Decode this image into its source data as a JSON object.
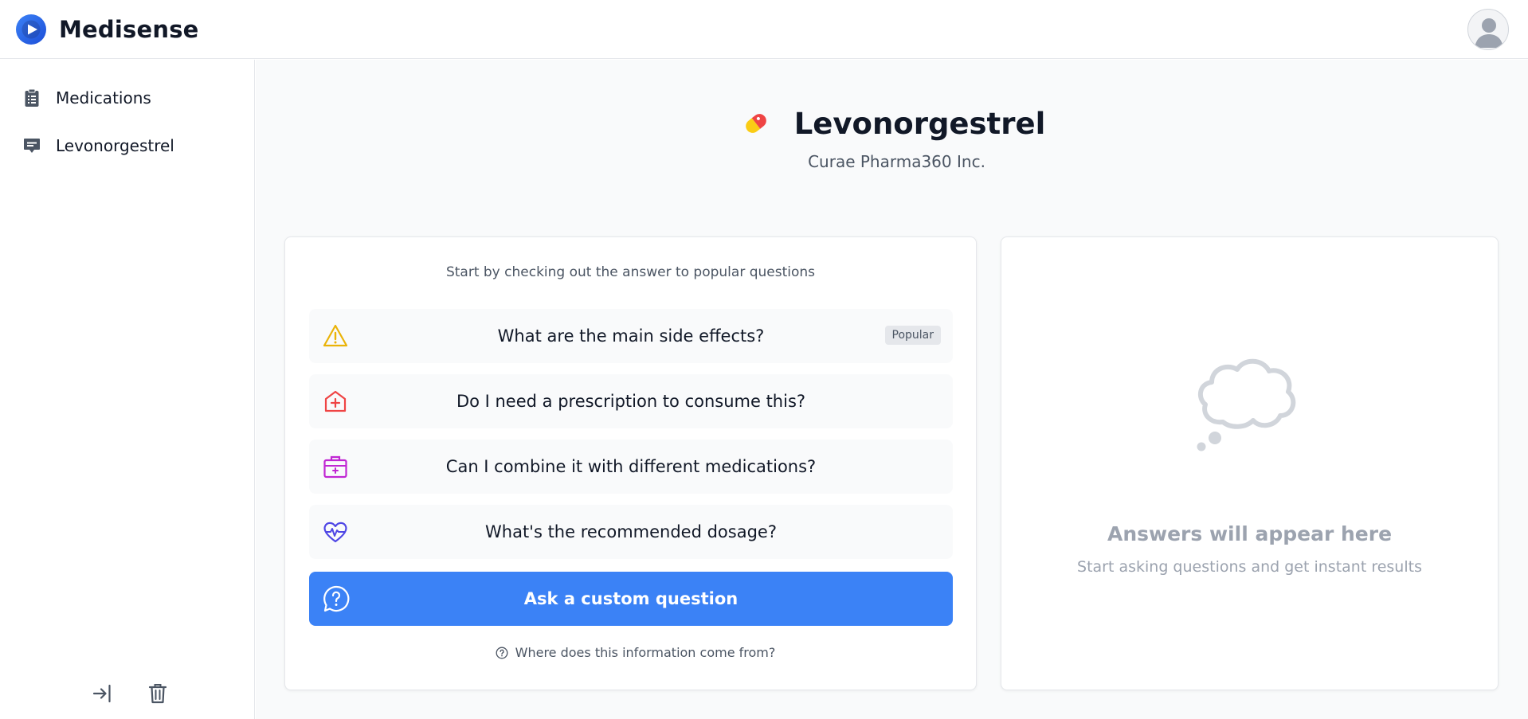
{
  "app": {
    "brand_name": "Medisense",
    "brand_color": "#2563eb"
  },
  "sidebar": {
    "items": [
      {
        "label": "Medications",
        "icon": "clipboard-list-icon"
      },
      {
        "label": "Levonorgestrel",
        "icon": "chat-bubble-icon"
      }
    ],
    "footer": [
      {
        "icon": "logout-icon"
      },
      {
        "icon": "trash-icon"
      }
    ]
  },
  "drug": {
    "name": "Levonorgestrel",
    "manufacturer": "Curae Pharma360 Inc.",
    "icon": "pill-icon"
  },
  "questions": {
    "intro": "Start by checking out the answer to popular questions",
    "items": [
      {
        "label": "What are the main side effects?",
        "icon": "warning-icon",
        "icon_color": "#eab308",
        "badge": "Popular"
      },
      {
        "label": "Do I need a prescription to consume this?",
        "icon": "hospital-plus-icon",
        "icon_color": "#ef4444"
      },
      {
        "label": "Can I combine it with different medications?",
        "icon": "first-aid-kit-icon",
        "icon_color": "#c026d3"
      },
      {
        "label": "What's the recommended dosage?",
        "icon": "heart-pulse-icon",
        "icon_color": "#4f46e5"
      }
    ],
    "ask_button": "Ask a custom question",
    "info_link": "Where does this information come from?",
    "accent": "#3b82f6"
  },
  "answers": {
    "empty_title": "Answers will appear here",
    "empty_subtitle": "Start asking questions and get instant results",
    "icon": "thought-bubble-icon"
  }
}
